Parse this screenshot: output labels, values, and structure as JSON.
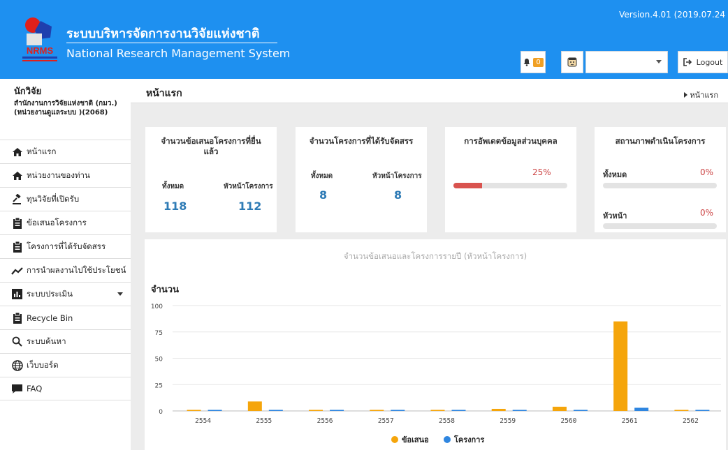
{
  "header": {
    "title_th": "ระบบบริหารจัดการงานวิจัยแห่งชาติ",
    "title_en": "National Research Management System",
    "logo_text": "NRMS",
    "version": "Version.4.01 (2019.07.24",
    "notification_count": "0",
    "user_select_value": "",
    "logout_label": "Logout",
    "brand_color": "#1e90f0"
  },
  "sidebar": {
    "role": "นักวิจัย",
    "org": "สำนักงานการวิจัยแห่งชาติ (กมว.)(หน่วยงานดูแลระบบ )(2068)",
    "items": [
      {
        "label": "หน้าแรก",
        "icon": "home-icon"
      },
      {
        "label": "หน่วยงานของท่าน",
        "icon": "home-icon"
      },
      {
        "label": "ทุนวิจัยที่เปิดรับ",
        "icon": "gavel-icon"
      },
      {
        "label": "ข้อเสนอโครงการ",
        "icon": "clipboard-icon"
      },
      {
        "label": "โครงการที่ได้รับจัดสรร",
        "icon": "clipboard-icon"
      },
      {
        "label": "การนำผลงานไปใช้ประโยชน์",
        "icon": "trend-icon"
      },
      {
        "label": "ระบบประเมิน",
        "icon": "bar-chart-icon"
      },
      {
        "label": "Recycle Bin",
        "icon": "clipboard-icon"
      },
      {
        "label": "ระบบค้นหา",
        "icon": "search-icon"
      },
      {
        "label": "เว็บบอร์ด",
        "icon": "globe-icon"
      },
      {
        "label": "FAQ",
        "icon": "comment-icon"
      }
    ]
  },
  "page": {
    "title": "หน้าแรก",
    "breadcrumb": "หน้าแรก"
  },
  "cards": {
    "proposals": {
      "title": "จำนวนข้อเสนอโครงการที่ยื่นแล้ว",
      "total_label": "ทั้งหมด",
      "total_value": "118",
      "head_label": "หัวหน้าโครงการ",
      "head_value": "112"
    },
    "funded": {
      "title": "จำนวนโครงการที่ได้รับจัดสรร",
      "total_label": "ทั้งหมด",
      "total_value": "8",
      "head_label": "หัวหน้าโครงการ",
      "head_value": "8"
    },
    "profile": {
      "title": "การอัพเดตข้อมูลส่วนบุคคล",
      "percent_label": "25%",
      "progress": 0.25
    },
    "status": {
      "title": "สถานภาพดำเนินโครงการ",
      "total_label": "ทั้งหมด",
      "total_percent": "0%",
      "total_progress": 0,
      "head_label": "หัวหน้า",
      "head_percent": "0%",
      "head_progress": 0
    }
  },
  "chart_data": {
    "type": "bar",
    "title": "จำนวนข้อเสนอและโครงการรายปี (หัวหน้าโครงการ)",
    "ylabel": "จำนวน",
    "xlabel": "",
    "categories": [
      "2554",
      "2555",
      "2556",
      "2557",
      "2558",
      "2559",
      "2560",
      "2561",
      "2562"
    ],
    "yticks": [
      0,
      25,
      50,
      75,
      100
    ],
    "ylim": [
      0,
      100
    ],
    "grid": true,
    "legend_position": "bottom",
    "series": [
      {
        "name": "ข้อเสนอ",
        "color": "#f5a50b",
        "values": [
          1,
          9,
          0,
          1,
          1,
          2,
          4,
          85,
          0
        ]
      },
      {
        "name": "โครงการ",
        "color": "#2f86e0",
        "values": [
          0,
          0,
          0,
          0,
          0,
          0,
          1,
          3,
          1
        ]
      }
    ]
  }
}
